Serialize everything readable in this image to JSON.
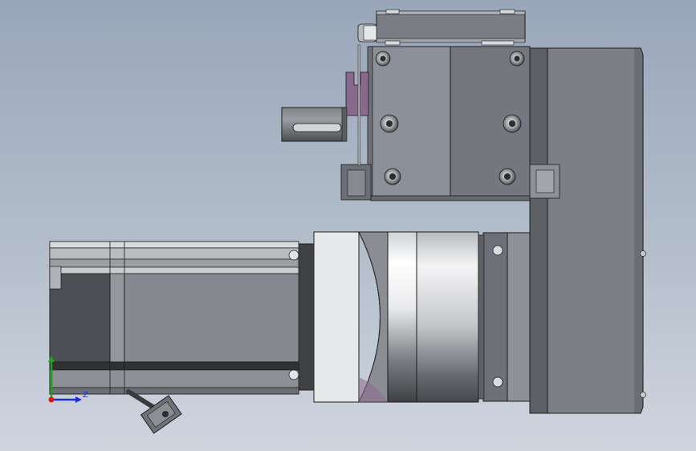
{
  "viewport": {
    "background_top": "#99a6b9",
    "background_bottom": "#cfd5df"
  },
  "colors": {
    "part_light": "#8e929a",
    "part_mid": "#7a7d83",
    "part_dark": "#55585d",
    "accent_purple": "#8a6a8c",
    "outline": "#1c1c1c",
    "axis_y": "#1fa31f",
    "axis_z": "#1a2fd6",
    "axis_origin": "#d11b1b"
  },
  "triad": {
    "z_label": "Z"
  }
}
